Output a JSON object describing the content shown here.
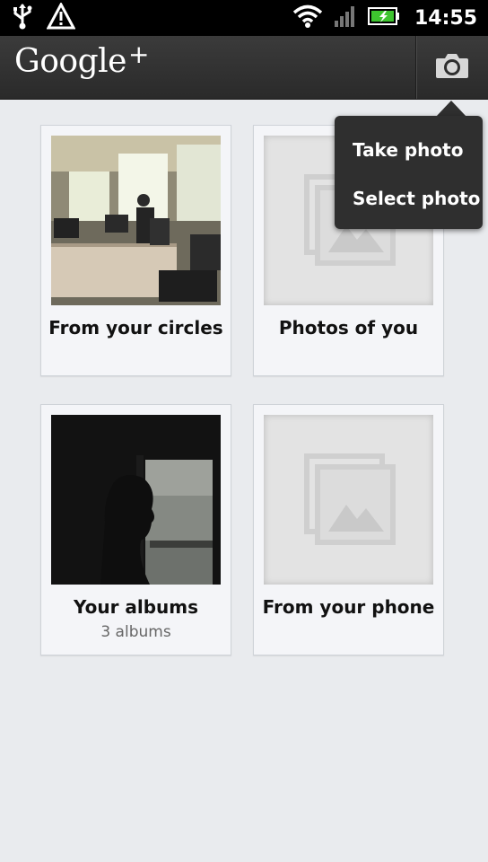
{
  "status_bar": {
    "time": "14:55",
    "icons": [
      "usb-icon",
      "warning-icon",
      "wifi-icon",
      "signal-icon",
      "battery-icon"
    ],
    "battery_color": "#3ec42f"
  },
  "action_bar": {
    "logo_text": "Google",
    "logo_plus": "+",
    "camera_icon": "camera-icon"
  },
  "tiles": [
    {
      "title": "From your circles",
      "subtitle": ""
    },
    {
      "title": "Photos of you",
      "subtitle": ""
    },
    {
      "title": "Your albums",
      "subtitle": "3 albums"
    },
    {
      "title": "From your phone",
      "subtitle": ""
    }
  ],
  "popup_menu": {
    "items": [
      {
        "label": "Take photo"
      },
      {
        "label": "Select photo"
      }
    ]
  },
  "colors": {
    "background": "#e9ebee",
    "action_bar": "#2e2e2e",
    "popup": "#2f2f2f"
  }
}
